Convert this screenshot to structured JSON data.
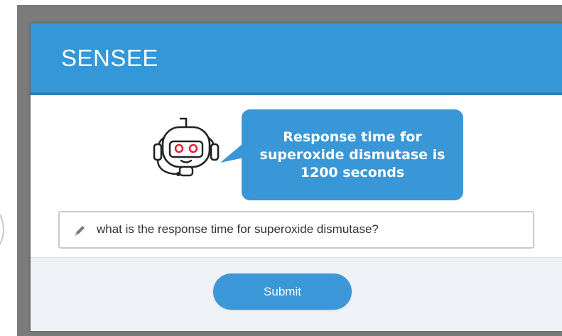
{
  "app": {
    "title": "SENSEE"
  },
  "assistant": {
    "icon": "robot-with-headset-icon",
    "response": "Response time for superoxide dismutase is 1200 seconds"
  },
  "query_input": {
    "icon": "pencil-icon",
    "value": "what is the response time for superoxide dismutase?"
  },
  "actions": {
    "submit_label": "Submit"
  },
  "colors": {
    "accent": "#3497d8",
    "header_border": "#2a7fba",
    "footer_bg": "#eef2f7",
    "frame": "#7b7b7b",
    "robot_eyes": "#e5223c"
  }
}
